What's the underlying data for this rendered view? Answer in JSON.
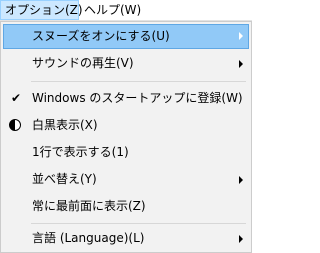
{
  "menubar": {
    "options_label": "オプション(Z)",
    "help_label": "ヘルプ(W)"
  },
  "menu": {
    "items": [
      {
        "label": "スヌーズをオンにする(U)",
        "submenu": true,
        "highlighted": true
      },
      {
        "label": "サウンドの再生(V)",
        "submenu": true
      },
      {
        "label": "Windows のスタートアップに登録(W)",
        "checked": true
      },
      {
        "label": "白黒表示(X)",
        "icon": "contrast-icon"
      },
      {
        "label": "1行で表示する(1)"
      },
      {
        "label": "並べ替え(Y)",
        "submenu": true
      },
      {
        "label": "常に最前面に表示(Z)"
      },
      {
        "label": "言語 (Language)(L)",
        "submenu": true
      }
    ]
  },
  "colors": {
    "highlight_bg": "#91c9f7",
    "highlight_border": "#5fa7e4",
    "menu_bg": "#f2f2f2",
    "menubar_active_bg": "#cce8ff"
  }
}
